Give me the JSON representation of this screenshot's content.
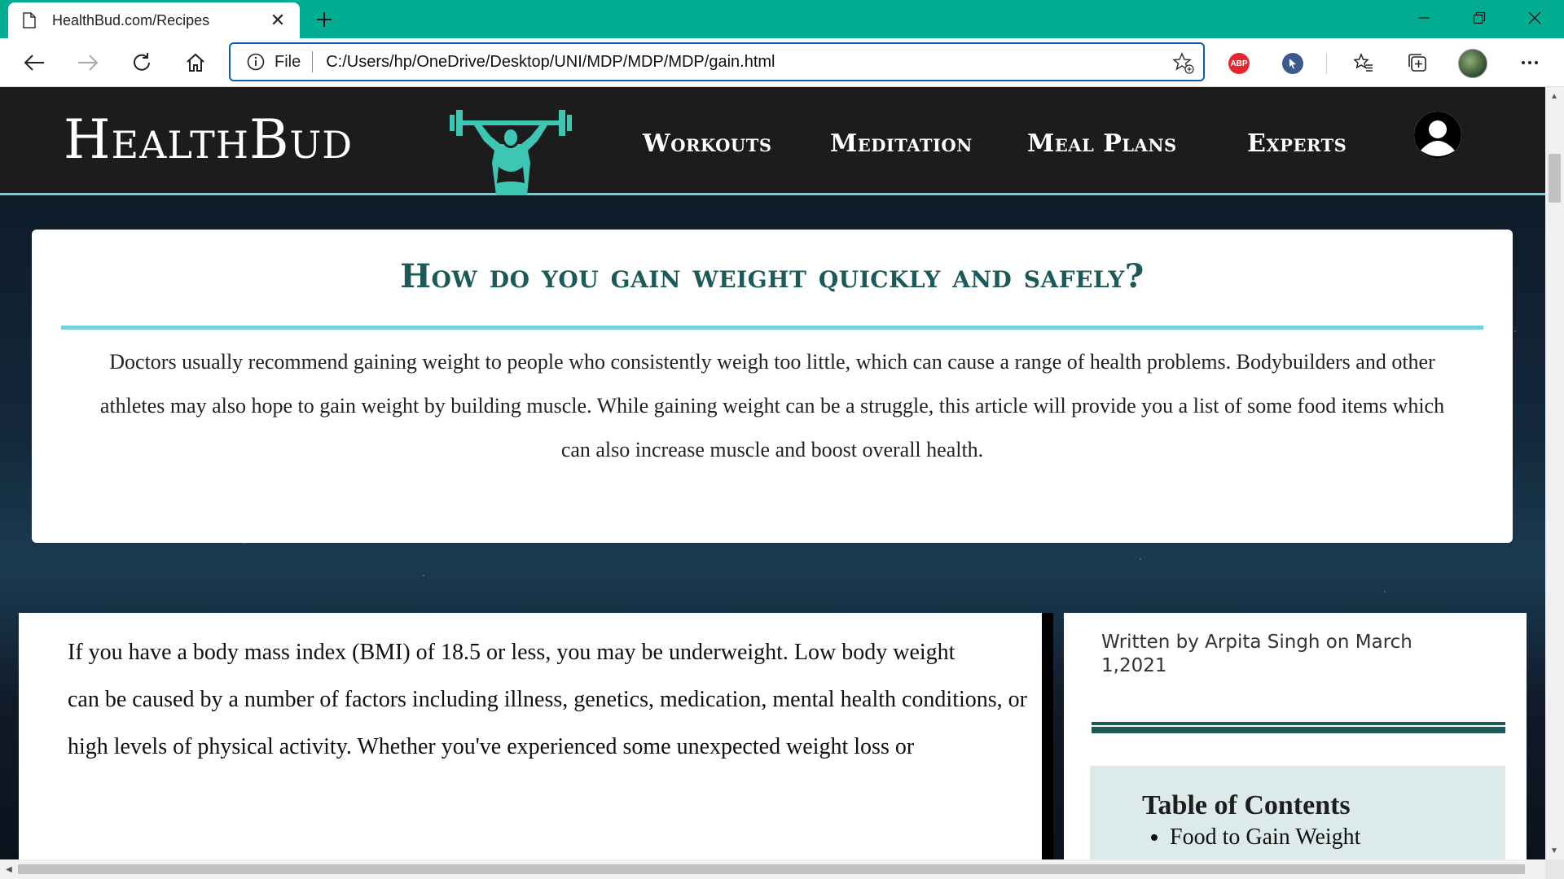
{
  "browser": {
    "tab_title": "HealthBud.com/Recipes",
    "address_scheme": "File",
    "address_url": "C:/Users/hp/OneDrive/Desktop/UNI/MDP/MDP/MDP/gain.html",
    "extension_abp": "ABP",
    "accent_color": "#03ad92"
  },
  "site": {
    "brand": "HealthBud",
    "nav": [
      "Workouts",
      "Meditation",
      "Meal Plans",
      "Experts"
    ]
  },
  "intro": {
    "title": "How do you gain weight quickly and safely?",
    "text": "Doctors usually recommend gaining weight to people who consistently weigh too little, which can cause a range of health problems. Bodybuilders and other athletes may also hope to gain weight by building muscle. While gaining weight can be a struggle, this article will provide you a list of some food items which can also increase muscle and boost overall health."
  },
  "article": {
    "lines": [
      "If you have a body mass index (BMI) of 18.5 or less, you may be underweight. Low body weight",
      "can be caused by a number of factors including illness, genetics, medication, mental health conditions, or",
      "high levels of physical activity. Whether you've experienced some unexpected weight loss or"
    ]
  },
  "sidebar": {
    "byline": "Written by Arpita Singh on March 1,2021",
    "toc_title": "Table of Contents",
    "toc_items": [
      "Food to Gain Weight"
    ]
  }
}
